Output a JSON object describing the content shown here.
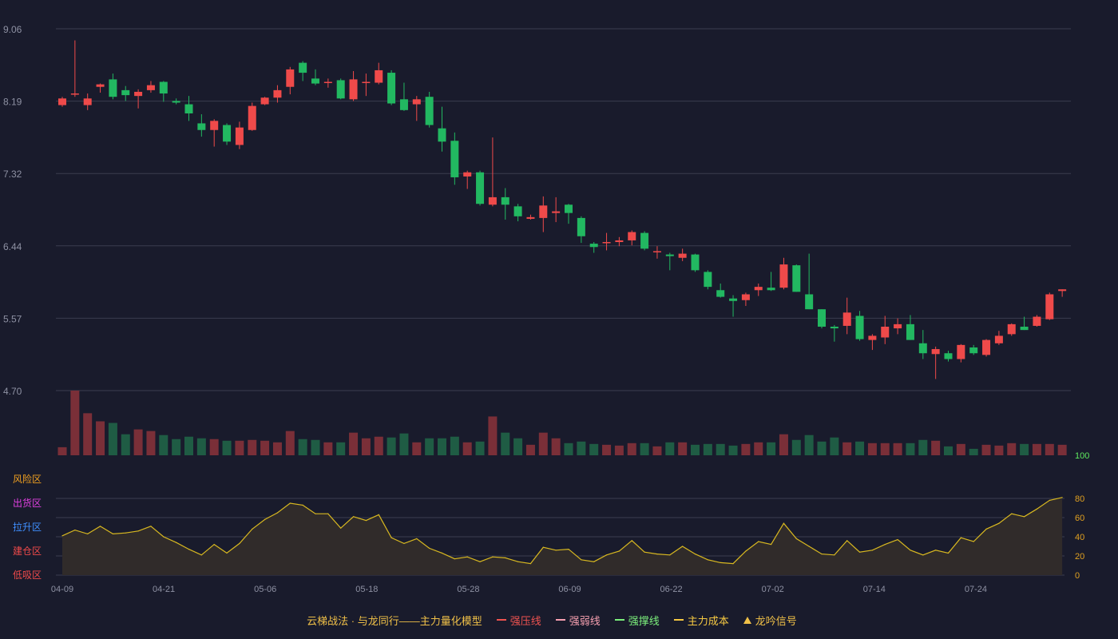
{
  "chart_data": {
    "type": "candlestick",
    "price_axis": {
      "ticks": [
        "9.06",
        "8.19",
        "7.32",
        "6.44",
        "5.57",
        "4.70"
      ],
      "min": 4.7,
      "max": 9.06
    },
    "x_labels": [
      "04-09",
      "04-21",
      "05-06",
      "05-18",
      "05-28",
      "06-09",
      "06-22",
      "07-02",
      "07-14",
      "07-24"
    ],
    "candles": [
      {
        "o": 8.14,
        "c": 8.22,
        "h": 8.24,
        "l": 8.12
      },
      {
        "o": 8.27,
        "c": 8.28,
        "h": 8.92,
        "l": 8.24
      },
      {
        "o": 8.14,
        "c": 8.22,
        "h": 8.28,
        "l": 8.08
      },
      {
        "o": 8.36,
        "c": 8.39,
        "h": 8.4,
        "l": 8.29
      },
      {
        "o": 8.45,
        "c": 8.24,
        "h": 8.52,
        "l": 8.21
      },
      {
        "o": 8.32,
        "c": 8.26,
        "h": 8.37,
        "l": 8.19
      },
      {
        "o": 8.25,
        "c": 8.3,
        "h": 8.33,
        "l": 8.1
      },
      {
        "o": 8.32,
        "c": 8.38,
        "h": 8.43,
        "l": 8.29
      },
      {
        "o": 8.42,
        "c": 8.28,
        "h": 8.43,
        "l": 8.18
      },
      {
        "o": 8.19,
        "c": 8.17,
        "h": 8.22,
        "l": 8.15
      },
      {
        "o": 8.15,
        "c": 8.04,
        "h": 8.25,
        "l": 7.95
      },
      {
        "o": 7.92,
        "c": 7.84,
        "h": 8.03,
        "l": 7.76
      },
      {
        "o": 7.84,
        "c": 7.95,
        "h": 7.97,
        "l": 7.64
      },
      {
        "o": 7.9,
        "c": 7.7,
        "h": 7.92,
        "l": 7.66
      },
      {
        "o": 7.66,
        "c": 7.87,
        "h": 7.94,
        "l": 7.61
      },
      {
        "o": 7.84,
        "c": 8.13,
        "h": 8.17,
        "l": 7.83
      },
      {
        "o": 8.15,
        "c": 8.23,
        "h": 8.24,
        "l": 8.14
      },
      {
        "o": 8.23,
        "c": 8.32,
        "h": 8.38,
        "l": 8.17
      },
      {
        "o": 8.36,
        "c": 8.57,
        "h": 8.6,
        "l": 8.27
      },
      {
        "o": 8.65,
        "c": 8.53,
        "h": 8.67,
        "l": 8.43
      },
      {
        "o": 8.46,
        "c": 8.4,
        "h": 8.57,
        "l": 8.38
      },
      {
        "o": 8.41,
        "c": 8.42,
        "h": 8.46,
        "l": 8.35
      },
      {
        "o": 8.44,
        "c": 8.22,
        "h": 8.46,
        "l": 8.21
      },
      {
        "o": 8.21,
        "c": 8.45,
        "h": 8.55,
        "l": 8.19
      },
      {
        "o": 8.41,
        "c": 8.42,
        "h": 8.52,
        "l": 8.25
      },
      {
        "o": 8.41,
        "c": 8.56,
        "h": 8.65,
        "l": 8.39
      },
      {
        "o": 8.53,
        "c": 8.16,
        "h": 8.56,
        "l": 8.14
      },
      {
        "o": 8.21,
        "c": 8.08,
        "h": 8.41,
        "l": 8.07
      },
      {
        "o": 8.15,
        "c": 8.21,
        "h": 8.25,
        "l": 7.95
      },
      {
        "o": 8.24,
        "c": 7.9,
        "h": 8.3,
        "l": 7.87
      },
      {
        "o": 7.86,
        "c": 7.7,
        "h": 8.12,
        "l": 7.58
      },
      {
        "o": 7.71,
        "c": 7.27,
        "h": 7.81,
        "l": 7.18
      },
      {
        "o": 7.28,
        "c": 7.33,
        "h": 7.35,
        "l": 7.13
      },
      {
        "o": 7.33,
        "c": 6.95,
        "h": 7.35,
        "l": 6.93
      },
      {
        "o": 6.94,
        "c": 7.03,
        "h": 7.75,
        "l": 6.92
      },
      {
        "o": 7.03,
        "c": 6.94,
        "h": 7.14,
        "l": 6.76
      },
      {
        "o": 6.92,
        "c": 6.8,
        "h": 6.95,
        "l": 6.74
      },
      {
        "o": 6.77,
        "c": 6.79,
        "h": 6.82,
        "l": 6.76
      },
      {
        "o": 6.78,
        "c": 6.93,
        "h": 7.04,
        "l": 6.61
      },
      {
        "o": 6.84,
        "c": 6.86,
        "h": 7.03,
        "l": 6.73
      },
      {
        "o": 6.94,
        "c": 6.84,
        "h": 6.95,
        "l": 6.71
      },
      {
        "o": 6.78,
        "c": 6.56,
        "h": 6.8,
        "l": 6.48
      },
      {
        "o": 6.47,
        "c": 6.43,
        "h": 6.49,
        "l": 6.36
      },
      {
        "o": 6.49,
        "c": 6.49,
        "h": 6.6,
        "l": 6.39
      },
      {
        "o": 6.49,
        "c": 6.51,
        "h": 6.55,
        "l": 6.44
      },
      {
        "o": 6.51,
        "c": 6.61,
        "h": 6.63,
        "l": 6.45
      },
      {
        "o": 6.6,
        "c": 6.41,
        "h": 6.62,
        "l": 6.39
      },
      {
        "o": 6.37,
        "c": 6.38,
        "h": 6.44,
        "l": 6.29
      },
      {
        "o": 6.34,
        "c": 6.32,
        "h": 6.36,
        "l": 6.15
      },
      {
        "o": 6.3,
        "c": 6.35,
        "h": 6.41,
        "l": 6.26
      },
      {
        "o": 6.34,
        "c": 6.15,
        "h": 6.35,
        "l": 6.13
      },
      {
        "o": 6.13,
        "c": 5.95,
        "h": 6.15,
        "l": 5.92
      },
      {
        "o": 5.91,
        "c": 5.83,
        "h": 5.99,
        "l": 5.82
      },
      {
        "o": 5.81,
        "c": 5.78,
        "h": 5.85,
        "l": 5.59
      },
      {
        "o": 5.79,
        "c": 5.86,
        "h": 5.88,
        "l": 5.72
      },
      {
        "o": 5.91,
        "c": 5.95,
        "h": 5.99,
        "l": 5.84
      },
      {
        "o": 5.94,
        "c": 5.91,
        "h": 6.13,
        "l": 5.9
      },
      {
        "o": 5.94,
        "c": 6.22,
        "h": 6.3,
        "l": 5.92
      },
      {
        "o": 6.21,
        "c": 5.89,
        "h": 6.22,
        "l": 5.89
      },
      {
        "o": 5.86,
        "c": 5.68,
        "h": 6.35,
        "l": 5.68
      },
      {
        "o": 5.68,
        "c": 5.47,
        "h": 5.68,
        "l": 5.45
      },
      {
        "o": 5.47,
        "c": 5.45,
        "h": 5.49,
        "l": 5.29
      },
      {
        "o": 5.48,
        "c": 5.64,
        "h": 5.82,
        "l": 5.38
      },
      {
        "o": 5.6,
        "c": 5.32,
        "h": 5.66,
        "l": 5.3
      },
      {
        "o": 5.31,
        "c": 5.36,
        "h": 5.38,
        "l": 5.19
      },
      {
        "o": 5.34,
        "c": 5.47,
        "h": 5.6,
        "l": 5.26
      },
      {
        "o": 5.45,
        "c": 5.5,
        "h": 5.57,
        "l": 5.38
      },
      {
        "o": 5.5,
        "c": 5.31,
        "h": 5.61,
        "l": 5.31
      },
      {
        "o": 5.27,
        "c": 5.15,
        "h": 5.43,
        "l": 5.08
      },
      {
        "o": 5.14,
        "c": 5.2,
        "h": 5.23,
        "l": 4.84
      },
      {
        "o": 5.15,
        "c": 5.08,
        "h": 5.18,
        "l": 5.05
      },
      {
        "o": 5.08,
        "c": 5.25,
        "h": 5.26,
        "l": 5.04
      },
      {
        "o": 5.22,
        "c": 5.15,
        "h": 5.25,
        "l": 5.13
      },
      {
        "o": 5.13,
        "c": 5.31,
        "h": 5.32,
        "l": 5.11
      },
      {
        "o": 5.27,
        "c": 5.36,
        "h": 5.42,
        "l": 5.25
      },
      {
        "o": 5.38,
        "c": 5.5,
        "h": 5.51,
        "l": 5.36
      },
      {
        "o": 5.47,
        "c": 5.43,
        "h": 5.59,
        "l": 5.43
      },
      {
        "o": 5.48,
        "c": 5.59,
        "h": 5.61,
        "l": 5.47
      },
      {
        "o": 5.56,
        "c": 5.86,
        "h": 5.88,
        "l": 5.55
      },
      {
        "o": 5.9,
        "c": 5.92,
        "h": 5.92,
        "l": 5.83
      }
    ],
    "volume": [
      10,
      80,
      52,
      42,
      40,
      26,
      32,
      30,
      25,
      20,
      23,
      21,
      20,
      18,
      18,
      19,
      18,
      16,
      30,
      20,
      19,
      16,
      16,
      28,
      21,
      23,
      22,
      27,
      16,
      21,
      21,
      23,
      16,
      17,
      48,
      28,
      21,
      13,
      28,
      21,
      15,
      17,
      14,
      13,
      12,
      15,
      15,
      11,
      16,
      16,
      13,
      14,
      14,
      12,
      14,
      16,
      16,
      26,
      19,
      25,
      17,
      22,
      16,
      17,
      15,
      15,
      15,
      15,
      19,
      18,
      11,
      14,
      8,
      13,
      12,
      15,
      14,
      14,
      14,
      13
    ],
    "indicator": {
      "axis_ticks": [
        "100",
        "80",
        "60",
        "40",
        "20",
        "0"
      ],
      "zones": [
        "风险区",
        "出货区",
        "拉升区",
        "建仓区",
        "低吸区"
      ],
      "values": [
        41,
        47,
        43,
        51,
        43,
        44,
        46,
        51,
        40,
        34,
        27,
        21,
        32,
        23,
        33,
        48,
        58,
        65,
        75,
        73,
        64,
        64,
        49,
        61,
        57,
        63,
        39,
        33,
        38,
        28,
        23,
        17,
        19,
        14,
        19,
        18,
        14,
        12,
        29,
        26,
        27,
        16,
        14,
        21,
        25,
        36,
        24,
        22,
        21,
        30,
        22,
        16,
        13,
        12,
        25,
        35,
        32,
        54,
        38,
        30,
        22,
        21,
        36,
        24,
        26,
        32,
        37,
        26,
        21,
        26,
        23,
        39,
        35,
        48,
        54,
        64,
        61,
        69,
        78,
        81
      ]
    },
    "legend": {
      "title": "云梯战法 · 与龙同行——主力量化模型",
      "items": [
        {
          "label": "强压线",
          "color": "#ef5350",
          "style": "solid"
        },
        {
          "label": "强弱线",
          "color": "#f7a0b0",
          "style": "dashed"
        },
        {
          "label": "强撑线",
          "color": "#7cf07c",
          "style": "solid"
        },
        {
          "label": "主力成本",
          "color": "#f5c842",
          "style": "dashed"
        },
        {
          "label": "龙吟信号",
          "color": "#f0c048",
          "style": "triangle"
        }
      ]
    },
    "colors": {
      "up": "#ef4a4a",
      "down": "#22b861",
      "volume_up": "#7a2f38",
      "volume_down": "#1f5c44",
      "indicator_line": "#d8b820",
      "indicator_fill": "#302b2a",
      "grid": "#3a3d4f",
      "axis_text": "#8e91a3",
      "indicator_axis": "#e0a020",
      "indicator_axis_top": "#5ee85e",
      "zone_colors": [
        "#f0a020",
        "#e040e0",
        "#3f8fff",
        "#ef4a4a",
        "#ef4a4a"
      ]
    }
  }
}
